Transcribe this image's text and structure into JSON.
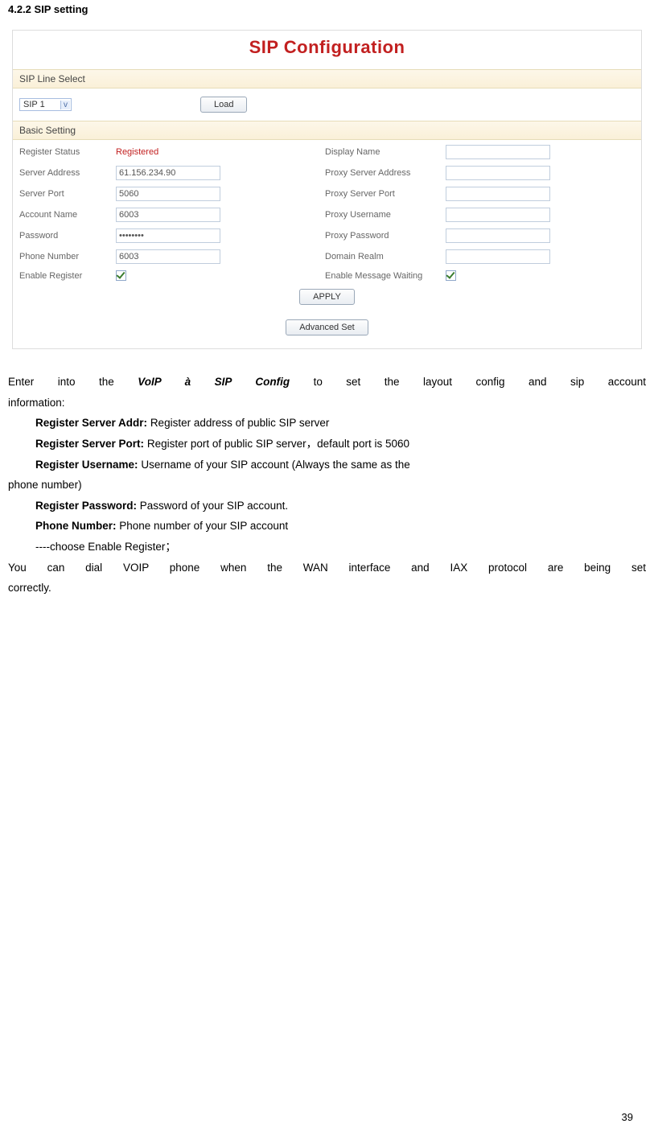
{
  "heading": "4.2.2 SIP setting",
  "config": {
    "title": "SIP Configuration",
    "section_line_select": "SIP Line Select",
    "sip_line_value": "SIP 1",
    "load_button": "Load",
    "section_basic": "Basic Setting",
    "rows_left": [
      {
        "label": "Register Status",
        "value": "Registered",
        "type": "status"
      },
      {
        "label": "Server Address",
        "value": "61.156.234.90",
        "type": "input"
      },
      {
        "label": "Server Port",
        "value": "5060",
        "type": "input"
      },
      {
        "label": "Account Name",
        "value": "6003",
        "type": "input"
      },
      {
        "label": "Password",
        "value": "••••••••",
        "type": "input"
      },
      {
        "label": "Phone Number",
        "value": "6003",
        "type": "input"
      },
      {
        "label": "Enable Register",
        "value": "",
        "type": "checkbox"
      }
    ],
    "rows_right": [
      {
        "label": "Display Name",
        "value": "",
        "type": "input"
      },
      {
        "label": "Proxy Server Address",
        "value": "",
        "type": "input"
      },
      {
        "label": "Proxy Server Port",
        "value": "",
        "type": "input"
      },
      {
        "label": "Proxy Username",
        "value": "",
        "type": "input"
      },
      {
        "label": "Proxy Password",
        "value": "",
        "type": "input"
      },
      {
        "label": "Domain Realm",
        "value": "",
        "type": "input"
      },
      {
        "label": "Enable Message Waiting",
        "value": "",
        "type": "checkbox"
      }
    ],
    "apply_button": "APPLY",
    "advanced_button": "Advanced Set"
  },
  "body": {
    "p1_a": "Enter into the ",
    "p1_b": "VoIP à SIP Config",
    "p1_c": " to set the layout config and sip account",
    "p1_line2": "information:",
    "l1_b": "Register Server Addr: ",
    "l1_t": "Register address of public SIP server",
    "l2_b": "Register Server Port:",
    "l2_t": " Register port of public SIP server，default port is 5060",
    "l3_b": "Register Username:",
    "l3_t": " Username of your SIP account (Always the same as the",
    "l3_line2": "phone number)",
    "l4_b": "Register Password:",
    "l4_t": " Password of your SIP account.",
    "l5_b": "Phone Number:",
    "l5_t": " Phone number of your SIP account",
    "l6": "----choose Enable Register；",
    "p2_line1": "You can dial VOIP phone when the WAN interface and IAX protocol are being set",
    "p2_line2": "correctly."
  },
  "page_number": "39"
}
